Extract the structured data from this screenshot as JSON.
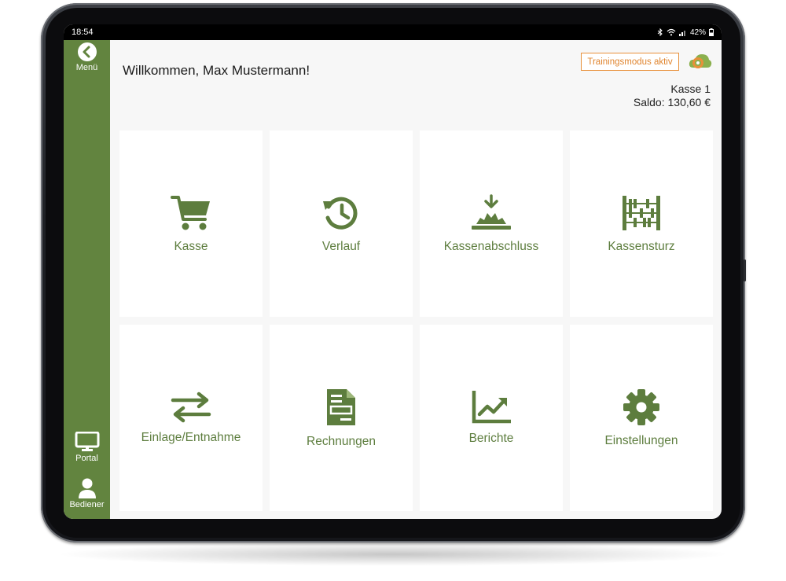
{
  "statusbar": {
    "time": "18:54",
    "battery": "42%"
  },
  "sidebar": {
    "menu_label": "Menü",
    "portal_label": "Portal",
    "operator_label": "Bediener"
  },
  "header": {
    "welcome": "Willkommen, Max Mustermann!",
    "training_badge": "Trainingsmodus aktiv",
    "register": "Kasse 1",
    "balance": "Saldo: 130,60 €"
  },
  "tiles": [
    {
      "label": "Kasse",
      "icon": "cart-icon"
    },
    {
      "label": "Verlauf",
      "icon": "history-icon"
    },
    {
      "label": "Kassenabschluss",
      "icon": "register-close-icon"
    },
    {
      "label": "Kassensturz",
      "icon": "abacus-icon"
    },
    {
      "label": "Einlage/Entnahme",
      "icon": "transfer-arrows-icon"
    },
    {
      "label": "Rechnungen",
      "icon": "invoice-icon"
    },
    {
      "label": "Berichte",
      "icon": "chart-icon"
    },
    {
      "label": "Einstellungen",
      "icon": "gear-icon"
    }
  ],
  "colors": {
    "brand_green": "#62843f",
    "accent_orange": "#e8903a",
    "icon_green": "#5d7d3e"
  }
}
